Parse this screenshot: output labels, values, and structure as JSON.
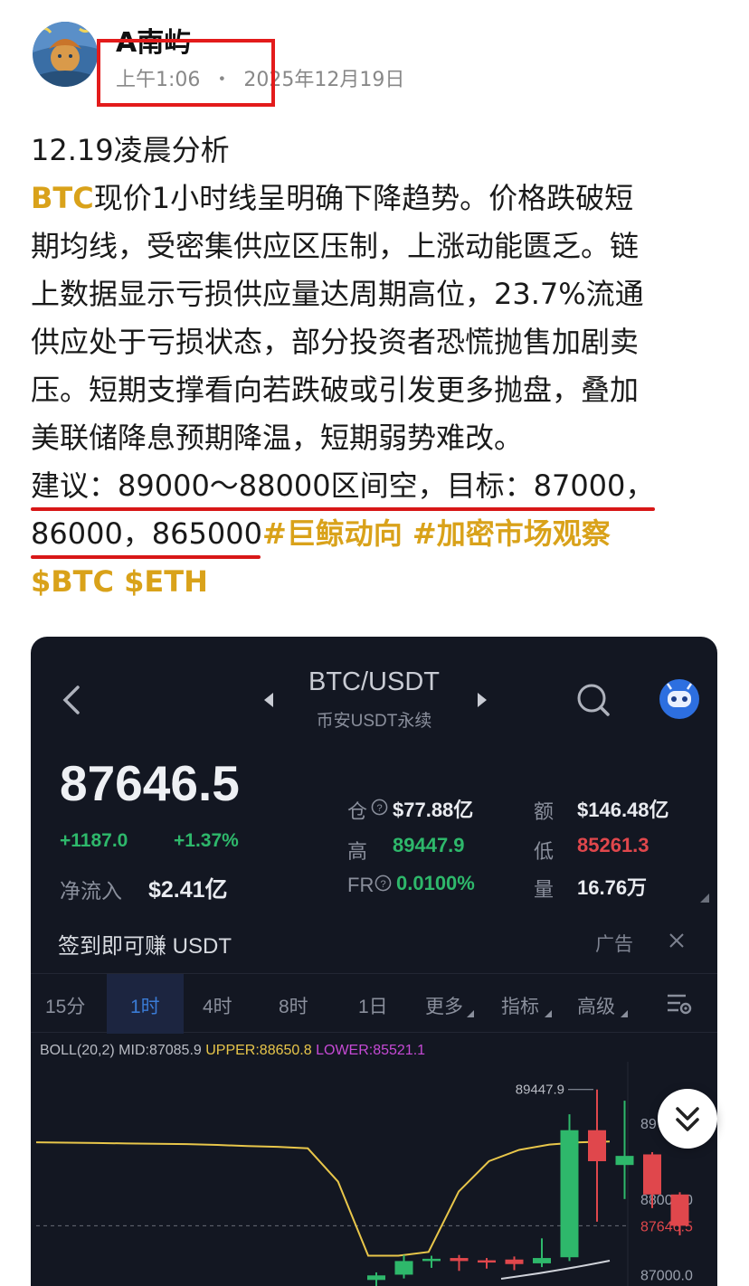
{
  "author": {
    "name": "A南屿",
    "time": "上午1:06",
    "sep": "・",
    "date": "2025年12月19日"
  },
  "post": {
    "title": "12.19凌晨分析",
    "line1_tag": "BTC",
    "line1_rest": "现价1小时线呈明确下降趋势。价格跌破短",
    "line2": "期均线，受密集供应区压制，上涨动能匮乏。链",
    "line3": "上数据显示亏损供应量达周期高位，23.7%流通",
    "line4": "供应处于亏损状态，部分投资者恐慌抛售加剧卖",
    "line5": "压。短期支撑看向若跌破或引发更多抛盘，叠加",
    "line6": "美联储降息预期降温，短期弱势难改。",
    "line7": "建议：89000～88000区间空，目标：87000，",
    "line8_plain": "86000，865000",
    "hashtags": "#巨鲸动向 #加密市场观察",
    "cashtags": "$BTC $ETH"
  },
  "card": {
    "pair": "BTC/USDT",
    "market": "币安USDT永续",
    "last_price": "87646.5",
    "change_abs": "+1187.0",
    "change_pct": "+1.37%",
    "netflow_label": "净流入",
    "netflow_value": "$2.41亿",
    "stats": {
      "oi_label": "仓",
      "oi_value": "$77.88亿",
      "amt_label": "额",
      "amt_value": "$146.48亿",
      "high_label": "高",
      "high_value": "89447.9",
      "low_label": "低",
      "low_value": "85261.3",
      "fr_label": "FR",
      "fr_value": "0.0100%",
      "vol_label": "量",
      "vol_value": "16.76万"
    },
    "promo": "签到即可赚 USDT",
    "ad_label": "广告",
    "tabs": [
      "15分",
      "1时",
      "4时",
      "8时",
      "1日",
      "更多",
      "指标",
      "高级"
    ],
    "active_tab": "1时",
    "boll": {
      "name": "BOLL(20,2)",
      "mid": "MID:87085.9",
      "upper": "UPPER:88650.8",
      "lower": "LOWER:85521.1"
    },
    "colors": {
      "up": "#2eb86b",
      "down": "#e0474c",
      "boll_mid": "#e8c64a",
      "background": "#131722"
    }
  },
  "chart_data": {
    "type": "candlestick",
    "high_marker": "89447.9",
    "current_price_label": "87646.5",
    "y_tick_labels": [
      "89",
      "88000.0",
      "87000.0"
    ],
    "y_ticks": [
      89000,
      88000,
      87000
    ],
    "ylim": [
      86850,
      89600
    ],
    "candles": [
      {
        "o": 86930,
        "c": 86990,
        "h": 87030,
        "l": 86850
      },
      {
        "o": 87000,
        "c": 87180,
        "h": 87260,
        "l": 86950
      },
      {
        "o": 87180,
        "c": 87210,
        "h": 87250,
        "l": 87090
      },
      {
        "o": 87220,
        "c": 87180,
        "h": 87260,
        "l": 87050
      },
      {
        "o": 87190,
        "c": 87160,
        "h": 87220,
        "l": 87080
      },
      {
        "o": 87200,
        "c": 87140,
        "h": 87240,
        "l": 87060
      },
      {
        "o": 87150,
        "c": 87220,
        "h": 87480,
        "l": 87100
      },
      {
        "o": 87230,
        "c": 88910,
        "h": 89120,
        "l": 87180
      },
      {
        "o": 88910,
        "c": 88500,
        "h": 89447.9,
        "l": 87700
      },
      {
        "o": 88450,
        "c": 88570,
        "h": 89300,
        "l": 88000
      },
      {
        "o": 88590,
        "c": 88060,
        "h": 88620,
        "l": 87880
      },
      {
        "o": 88060,
        "c": 87646.5,
        "h": 88090,
        "l": 87520
      }
    ],
    "boll_mid": [
      88750,
      88745,
      88740,
      88735,
      88730,
      88725,
      88715,
      88700,
      88690,
      88670,
      88230,
      87250,
      87250,
      87300,
      88100,
      88500,
      88650,
      88720,
      88750,
      88760
    ]
  }
}
